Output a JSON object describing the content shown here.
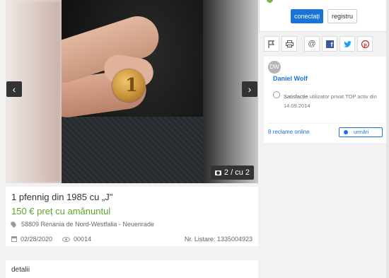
{
  "gallery": {
    "counter": "2 / cu 2",
    "prev_label": "‹",
    "next_label": "›"
  },
  "listing": {
    "title": "1 pfennig din 1985 cu „J\"",
    "price": "150 € preț cu amănuntul",
    "location": "58809 Renania de Nord-Westfalia - Neuenrade",
    "date": "02/28/2020",
    "views": "00014",
    "reference": "Nr. Listare: 1335004923"
  },
  "details": {
    "heading": "detalii"
  },
  "auth": {
    "login": "conectați",
    "register": "registru"
  },
  "share": {
    "facebook_glyph": "f",
    "twitter_glyph": "🐦",
    "pinterest_glyph": "P"
  },
  "seller": {
    "initials": "DW",
    "name": "Daniel Wolf",
    "satisfaction_label": "Satisfacție",
    "satisfaction_text": " utilizator privat TOP activ din 14.09.2014",
    "ads_count": "8 reclame online",
    "follow": "urmări"
  },
  "colors": {
    "accent": "#1a73d9",
    "price": "#5aa62b"
  }
}
